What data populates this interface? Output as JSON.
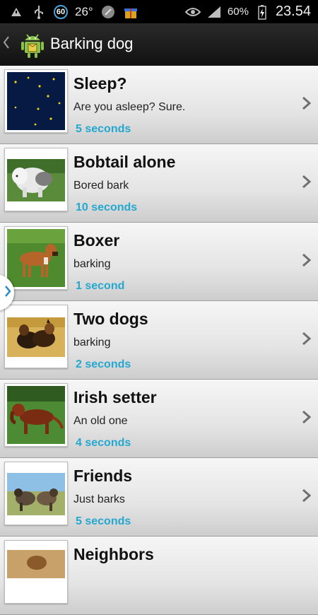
{
  "status_bar": {
    "left_icons": [
      "notification-icon",
      "usb-icon"
    ],
    "badge": "60",
    "temperature": "26°",
    "right_icons": [
      "eye-icon",
      "signal-icon"
    ],
    "battery_percent": "60%",
    "time": "23.54"
  },
  "action_bar": {
    "title": "Barking dog"
  },
  "items": [
    {
      "title": "Sleep?",
      "subtitle": "Are you asleep? Sure.",
      "duration": "5 seconds",
      "thumb": "night-sky"
    },
    {
      "title": "Bobtail alone",
      "subtitle": "Bored bark",
      "duration": "10 seconds",
      "thumb": "bobtail-dog"
    },
    {
      "title": "Boxer",
      "subtitle": "barking",
      "duration": "1 second",
      "thumb": "boxer-dog"
    },
    {
      "title": "Two dogs",
      "subtitle": "barking",
      "duration": "2 seconds",
      "thumb": "two-dogs"
    },
    {
      "title": "Irish setter",
      "subtitle": "An old one",
      "duration": "4 seconds",
      "thumb": "irish-setter"
    },
    {
      "title": "Friends",
      "subtitle": "Just barks",
      "duration": "5 seconds",
      "thumb": "friends-dogs"
    },
    {
      "title": "Neighbors",
      "subtitle": "",
      "duration": "",
      "thumb": "neighbors-dog"
    }
  ],
  "colors": {
    "accent_duration": "#25a8cf",
    "actionbar": "#1a1a1a"
  }
}
